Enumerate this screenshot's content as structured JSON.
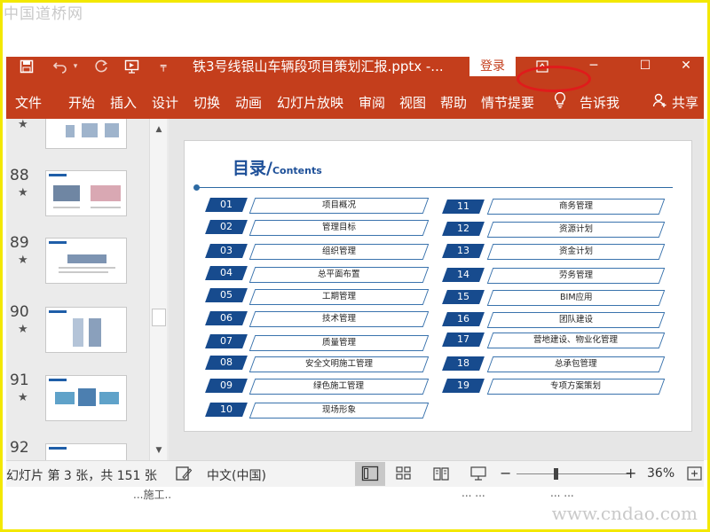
{
  "watermark_top": "中国道桥网",
  "watermark_bottom": "www.cndao.com",
  "titlebar": {
    "doc_title": "铁3号线银山车辆段项目策划汇报.pptx  -...",
    "login": "登录",
    "bg": "#c43e1c"
  },
  "ribbon": {
    "tabs": [
      "文件",
      "开始",
      "插入",
      "设计",
      "切换",
      "动画",
      "幻灯片放映",
      "审阅",
      "视图",
      "帮助",
      "情节提要"
    ],
    "tell_me": "告诉我",
    "share": "共享"
  },
  "thumbnails": [
    {
      "num": "88",
      "star": "★"
    },
    {
      "num": "89",
      "star": "★"
    },
    {
      "num": "90",
      "star": "★"
    },
    {
      "num": "91",
      "star": "★"
    },
    {
      "num": "92",
      "star": ""
    }
  ],
  "top_star": "★",
  "slide": {
    "title": "目录/",
    "title_en": "Contents",
    "left_items": [
      {
        "num": "01",
        "label": "项目概况"
      },
      {
        "num": "02",
        "label": "管理目标"
      },
      {
        "num": "03",
        "label": "组织管理"
      },
      {
        "num": "04",
        "label": "总平面布置"
      },
      {
        "num": "05",
        "label": "工期管理"
      },
      {
        "num": "06",
        "label": "技术管理"
      },
      {
        "num": "07",
        "label": "质量管理"
      },
      {
        "num": "08",
        "label": "安全文明施工管理"
      },
      {
        "num": "09",
        "label": "绿色施工管理"
      },
      {
        "num": "10",
        "label": "现场形象"
      }
    ],
    "right_items": [
      {
        "num": "11",
        "label": "商务管理"
      },
      {
        "num": "12",
        "label": "资源计划"
      },
      {
        "num": "13",
        "label": "资金计划"
      },
      {
        "num": "14",
        "label": "劳务管理"
      },
      {
        "num": "15",
        "label": "BIM应用"
      },
      {
        "num": "16",
        "label": "团队建设"
      },
      {
        "num": "17",
        "label": "营地建设、物业化管理"
      },
      {
        "num": "18",
        "label": "总承包管理"
      },
      {
        "num": "19",
        "label": "专项方案策划"
      }
    ]
  },
  "status": {
    "slide_info": "幻灯片 第 3 张，共 151 张",
    "language": "中文(中国)",
    "zoom": "36%",
    "zoom_level": 0.36
  },
  "footer_ghost": [
    "...施工..",
    "...  ...",
    "...  ..."
  ]
}
